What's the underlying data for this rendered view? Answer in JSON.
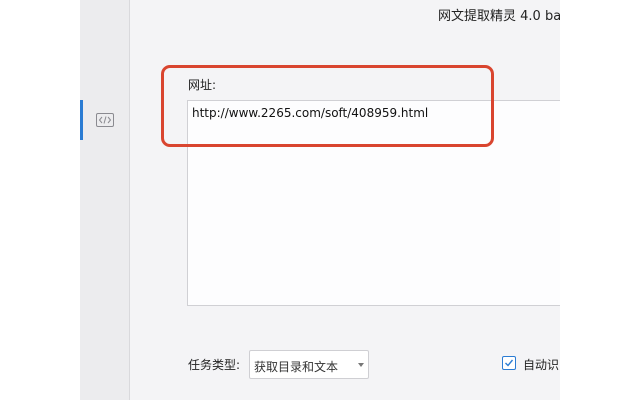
{
  "window": {
    "title": "网文提取精灵 4.0 ba"
  },
  "sidebar": {
    "items": [
      {
        "icon": "code-icon",
        "active": true
      }
    ]
  },
  "form": {
    "url_label": "网址:",
    "url_value": "http://www.2265.com/soft/408959.html",
    "task_type_label": "任务类型:",
    "task_type_value": "获取目录和文本",
    "auto_label": "自动识",
    "auto_checked": true
  },
  "colors": {
    "accent": "#2b7cd3",
    "highlight": "#d9452f"
  }
}
